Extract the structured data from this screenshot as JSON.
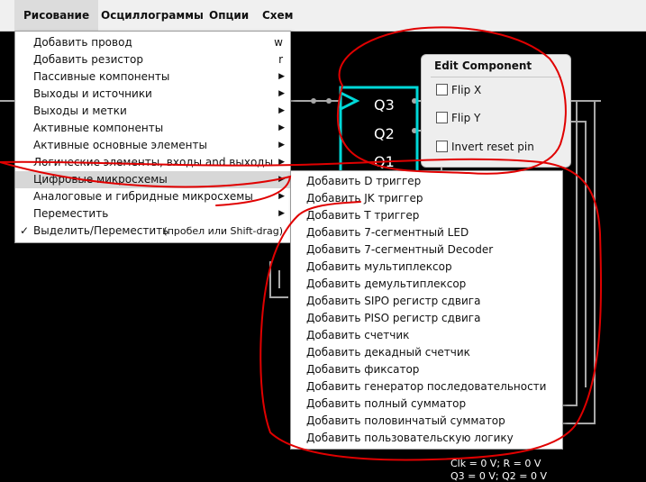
{
  "menubar": {
    "items": [
      "Рисование",
      "Осциллограммы",
      "Опции",
      "Схем"
    ]
  },
  "main_menu": [
    {
      "label": "Добавить провод",
      "shortcut": "w",
      "submenu": false
    },
    {
      "label": "Добавить резистор",
      "shortcut": "r",
      "submenu": false
    },
    {
      "label": "Пассивные компоненты",
      "shortcut": "",
      "submenu": true
    },
    {
      "label": "Выходы и источники",
      "shortcut": "",
      "submenu": true
    },
    {
      "label": "Выходы и метки",
      "shortcut": "",
      "submenu": true
    },
    {
      "label": "Активные компоненты",
      "shortcut": "",
      "submenu": true
    },
    {
      "label": "Активные основные элементы",
      "shortcut": "",
      "submenu": true
    },
    {
      "label": "Логические элементы, входы and выходы",
      "shortcut": "",
      "submenu": true
    },
    {
      "label": "Цифровые микросхемы",
      "shortcut": "",
      "submenu": true,
      "highlighted": true
    },
    {
      "label": "Аналоговые и гибридные микросхемы",
      "shortcut": "",
      "submenu": true
    },
    {
      "label": "Переместить",
      "shortcut": "",
      "submenu": true
    },
    {
      "label": "Выделить/Переместить",
      "shortcut": "(пробел или Shift-drag)",
      "submenu": false,
      "checked": true
    }
  ],
  "submenu": [
    "Добавить D триггер",
    "Добавить JK триггер",
    "Добавить T триггер",
    "Добавить 7-сегментный LED",
    "Добавить 7-сегментный Decoder",
    "Добавить мультиплексор",
    "Добавить демультиплексор",
    "Добавить SIPO регистр сдвига",
    "Добавить PISO регистр сдвига",
    "Добавить счетчик",
    "Добавить декадный счетчик",
    "Добавить фиксатор",
    "Добавить генератор последовательности",
    "Добавить полный сумматор",
    "Добавить половинчатый сумматор",
    "Добавить пользовательскую логику"
  ],
  "edit_component": {
    "title": "Edit Component",
    "options": [
      {
        "label": "Flip X",
        "checked": false
      },
      {
        "label": "Flip Y",
        "checked": false
      },
      {
        "label": "Invert reset pin",
        "checked": false
      }
    ]
  },
  "chip_pins": [
    "Q3",
    "Q2",
    "Q1"
  ],
  "status_lines": [
    "Clk = 0 V; R = 0 V",
    "Q3 = 0 V; Q2 = 0 V"
  ],
  "colors": {
    "chip": "#00d8d8",
    "wire": "#a8a8a8",
    "annotation": "#e00000",
    "highlight": "#d7d7d7"
  }
}
